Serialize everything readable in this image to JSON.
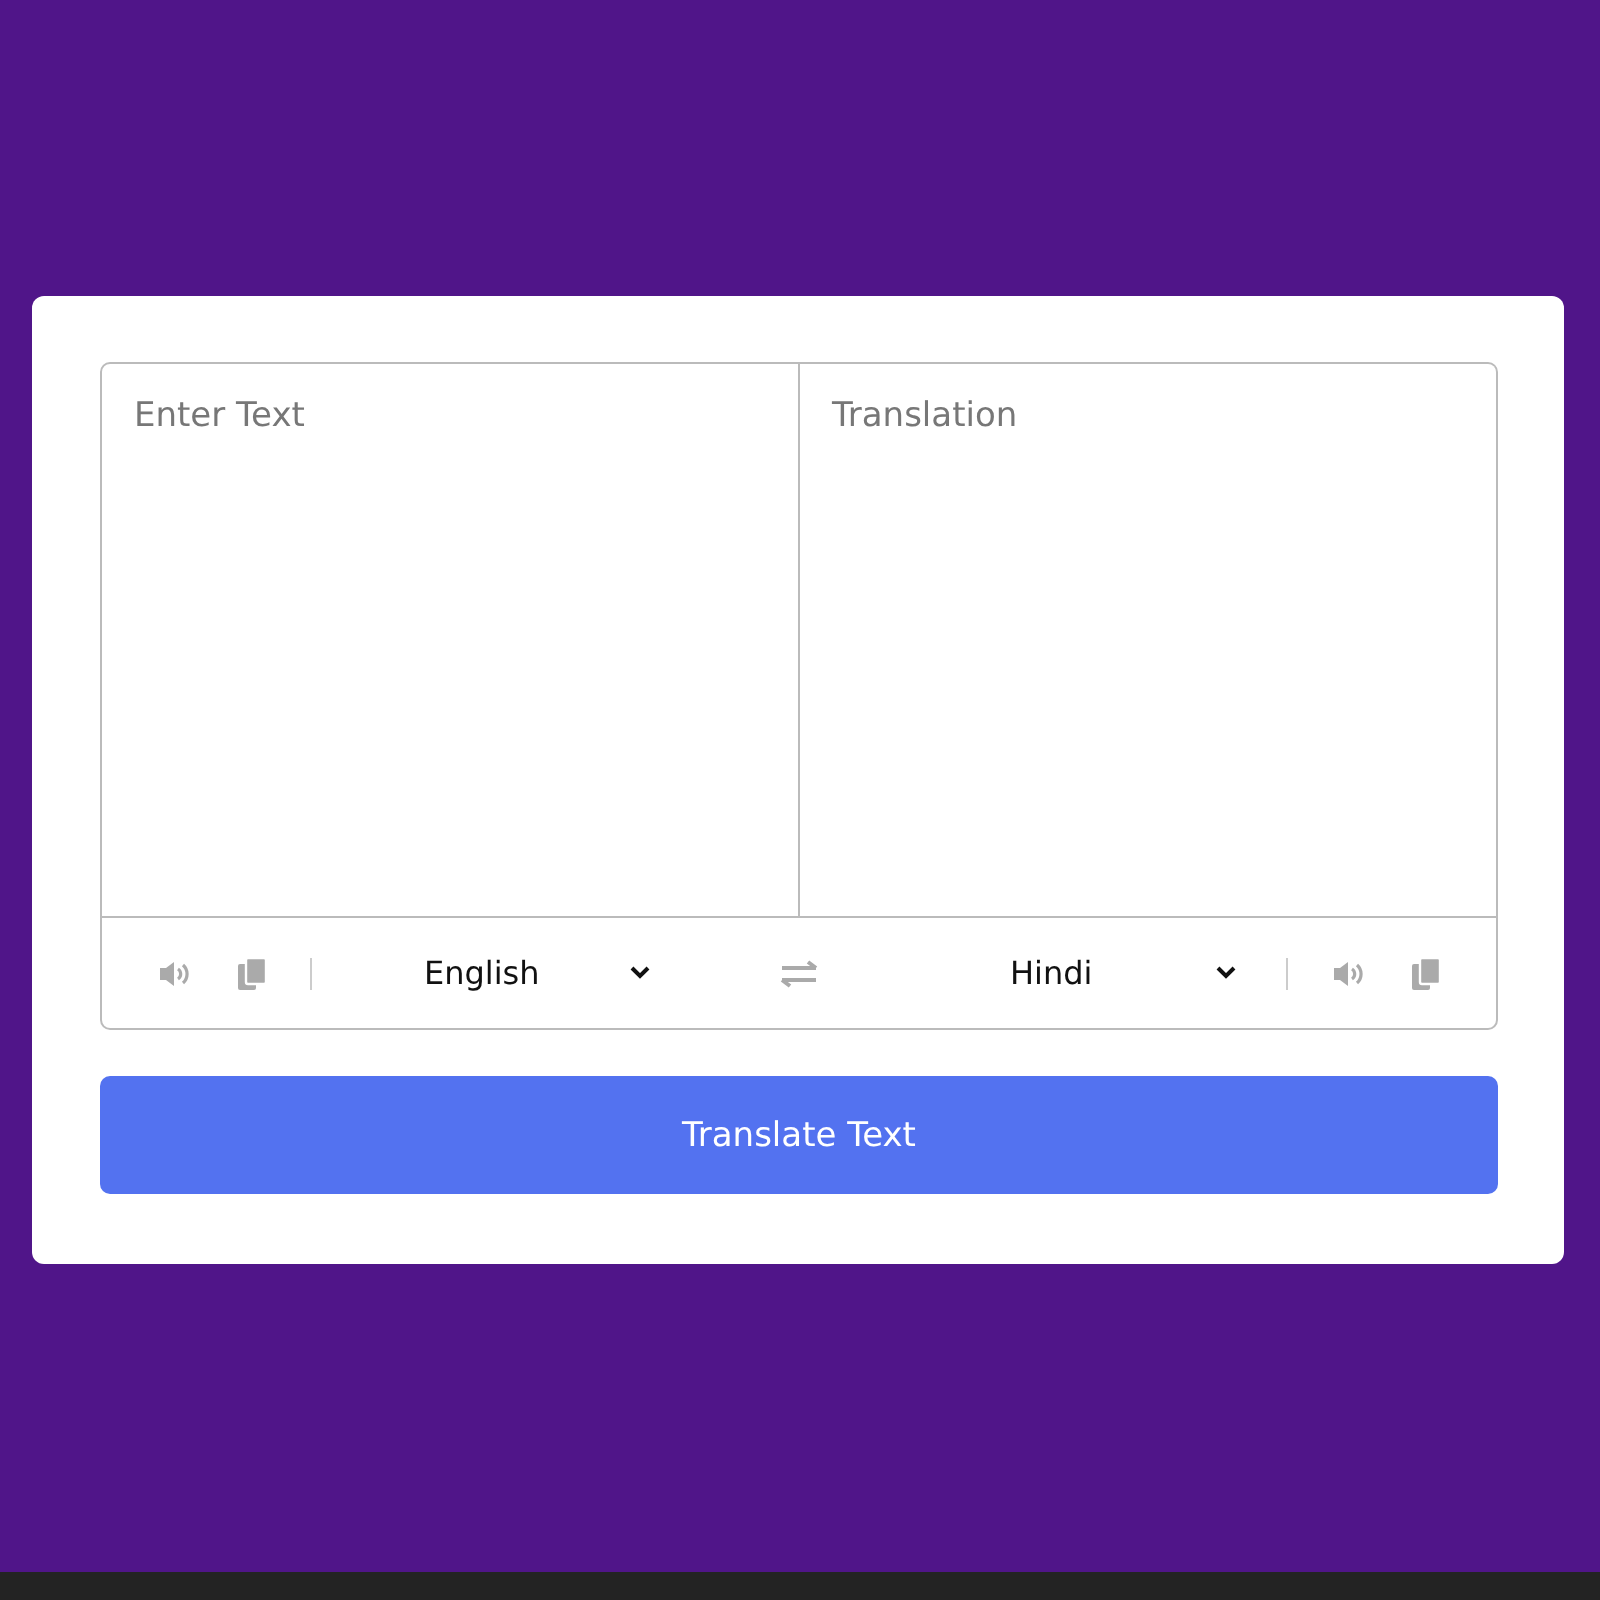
{
  "source": {
    "placeholder": "Enter Text",
    "language": "English"
  },
  "target": {
    "placeholder": "Translation",
    "language": "Hindi"
  },
  "button": {
    "label": "Translate Text"
  }
}
